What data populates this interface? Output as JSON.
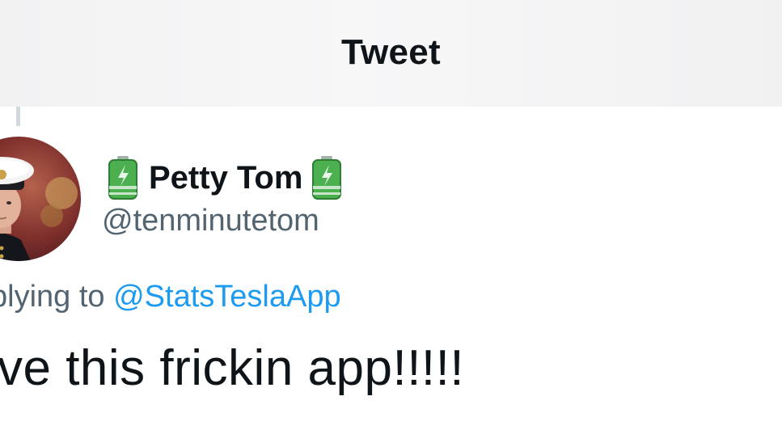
{
  "header": {
    "title": "Tweet"
  },
  "author": {
    "display_name": "Petty Tom",
    "handle": "@tenminutetom",
    "name_prefix_icon": "battery-icon",
    "name_suffix_icon": "battery-icon"
  },
  "reply": {
    "prefix": "plying to ",
    "mention": "@StatsTeslaApp",
    "mention_color": "#1d9bf0"
  },
  "tweet": {
    "text": "ove this frickin app!!!!!"
  },
  "colors": {
    "text_primary": "#0f1419",
    "text_secondary": "#536471",
    "battery_green": "#43a047"
  }
}
